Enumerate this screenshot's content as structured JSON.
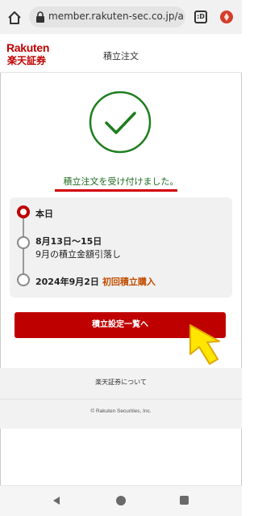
{
  "browser": {
    "url": "member.rakuten-sec.co.jp/app/",
    "tab_count": ":D"
  },
  "header": {
    "logo_en": "Rakuten",
    "logo_ja": "楽天証券",
    "title": "積立注文"
  },
  "confirmation": {
    "message": "積立注文を受け付けました。"
  },
  "timeline": {
    "step1": {
      "label": "本日"
    },
    "step2": {
      "dates": "8月13日〜15日",
      "detail": "9月の積立金額引落し"
    },
    "step3": {
      "date": "2024年9月2日",
      "tag": "初回積立購入"
    }
  },
  "cta": {
    "label": "積立設定一覧へ"
  },
  "footer": {
    "about": "楽天証券について",
    "copyright": "© Rakuten Securities, Inc."
  },
  "colors": {
    "brand_red": "#bf0000",
    "success_green": "#1e7d1e",
    "accent_orange": "#c24d00",
    "pointer_yellow": "#ffe600"
  }
}
